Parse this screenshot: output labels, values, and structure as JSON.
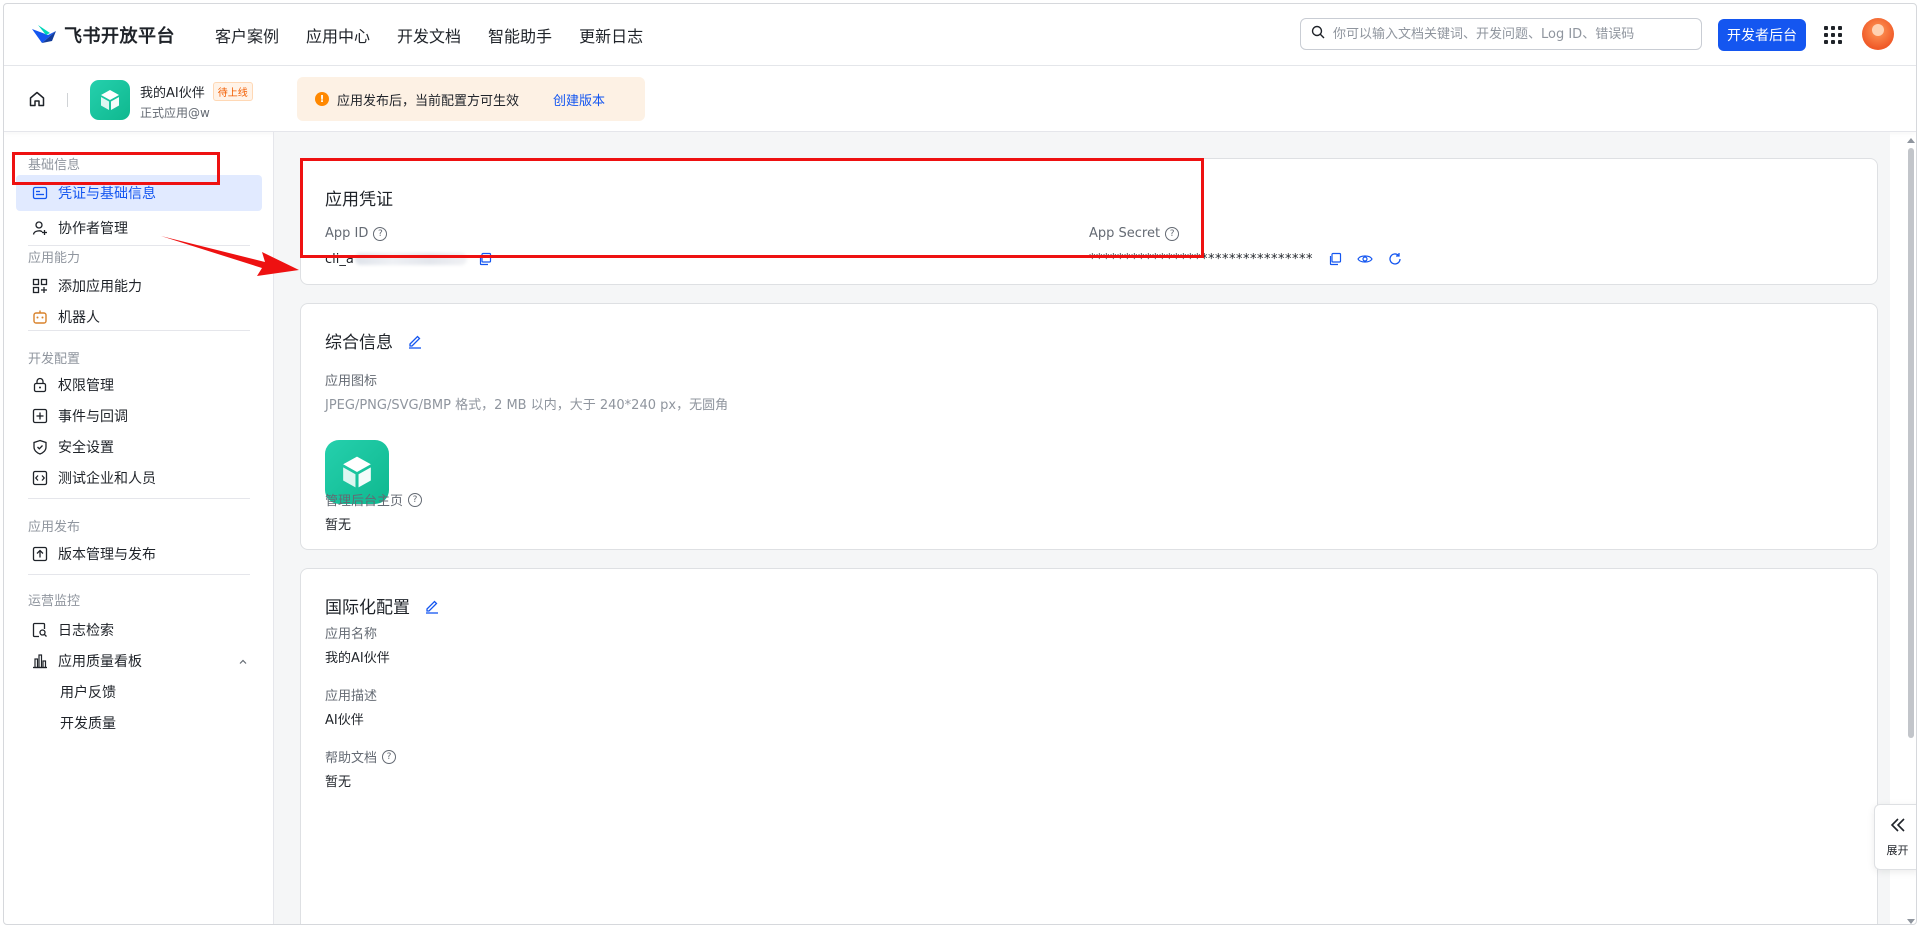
{
  "brand": {
    "name": "飞书开放平台"
  },
  "nav": {
    "links": [
      "客户案例",
      "应用中心",
      "开发文档",
      "智能助手",
      "更新日志"
    ],
    "search_placeholder": "你可以输入文档关键词、开发问题、Log ID、错误码",
    "dev_button": "开发者后台"
  },
  "app_header": {
    "app_name": "我的AI伙伴",
    "status_tag": "待上线",
    "app_type": "正式应用@w",
    "notice_text": "应用发布后，当前配置方可生效",
    "notice_link": "创建版本"
  },
  "sidebar": {
    "groups": [
      {
        "title": "基础信息",
        "items": [
          "凭证与基础信息",
          "协作者管理"
        ]
      },
      {
        "title": "应用能力",
        "items": [
          "添加应用能力",
          "机器人"
        ]
      },
      {
        "title": "开发配置",
        "items": [
          "权限管理",
          "事件与回调",
          "安全设置",
          "测试企业和人员"
        ]
      },
      {
        "title": "应用发布",
        "items": [
          "版本管理与发布"
        ]
      },
      {
        "title": "运营监控",
        "items": [
          "日志检索",
          "应用质量看板",
          "用户反馈",
          "开发质量"
        ]
      }
    ],
    "active_item": "凭证与基础信息"
  },
  "credentials": {
    "title": "应用凭证",
    "app_id_label": "App ID",
    "app_id_value_prefix": "cli_a",
    "app_secret_label": "App Secret",
    "app_secret_value": "********************************"
  },
  "general_info": {
    "title": "综合信息",
    "icon_label": "应用图标",
    "icon_hint": "JPEG/PNG/SVG/BMP 格式，2 MB 以内，大于 240*240 px，无圆角",
    "admin_home_label": "管理后台主页",
    "admin_home_value": "暂无"
  },
  "i18n": {
    "title": "国际化配置",
    "name_label": "应用名称",
    "name_value": "我的AI伙伴",
    "desc_label": "应用描述",
    "desc_value": "AI伙伴",
    "help_label": "帮助文档",
    "help_value": "暂无"
  },
  "expand": {
    "label": "展开"
  },
  "colors": {
    "accent": "#1456f0",
    "annotation": "#ee1111",
    "app_icon": "#1fc4a0",
    "warning": "#ff8800"
  }
}
